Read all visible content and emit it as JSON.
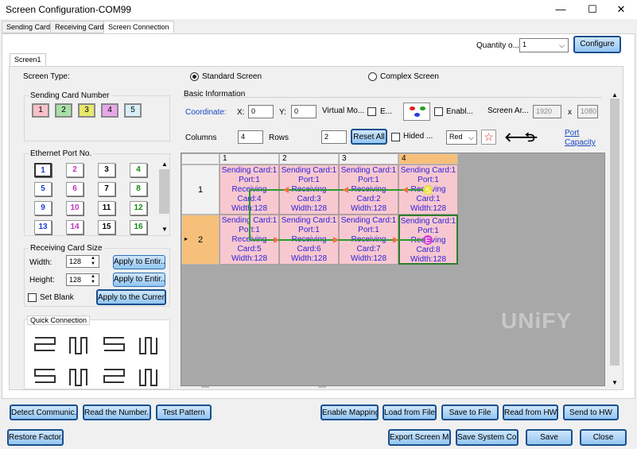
{
  "window": {
    "title": "Screen Configuration-COM99",
    "minimize": "—",
    "maximize": "☐",
    "close": "✕"
  },
  "tabs": [
    "Sending Card",
    "Receiving Card",
    "Screen Connection"
  ],
  "quantity": {
    "label": "Quantity o...",
    "value": "1",
    "configure": "Configure"
  },
  "screen_tab": "Screen1",
  "screen_type": {
    "label": "Screen Type:",
    "standard": "Standard Screen",
    "complex": "Complex Screen"
  },
  "sending_card": {
    "title": "Sending Card Number",
    "items": [
      {
        "label": "1",
        "color": "#f8c0c8"
      },
      {
        "label": "2",
        "color": "#a8e0a8"
      },
      {
        "label": "3",
        "color": "#e8e870"
      },
      {
        "label": "4",
        "color": "#e8a8e8"
      },
      {
        "label": "5",
        "color": "#d8eef8"
      }
    ]
  },
  "ethernet": {
    "title": "Ethernet Port No.",
    "ports": [
      {
        "label": "1",
        "color": "#1a3fd8"
      },
      {
        "label": "2",
        "color": "#c030c0"
      },
      {
        "label": "3",
        "color": "#000000"
      },
      {
        "label": "4",
        "color": "#128a12"
      },
      {
        "label": "5",
        "color": "#1a3fd8"
      },
      {
        "label": "6",
        "color": "#c030c0"
      },
      {
        "label": "7",
        "color": "#000000"
      },
      {
        "label": "8",
        "color": "#128a12"
      },
      {
        "label": "9",
        "color": "#1a3fd8"
      },
      {
        "label": "10",
        "color": "#c030c0"
      },
      {
        "label": "11",
        "color": "#000000"
      },
      {
        "label": "12",
        "color": "#128a12"
      },
      {
        "label": "13",
        "color": "#1a3fd8"
      },
      {
        "label": "14",
        "color": "#c030c0"
      },
      {
        "label": "15",
        "color": "#000000"
      },
      {
        "label": "16",
        "color": "#128a12"
      }
    ]
  },
  "recv_size": {
    "title": "Receiving Card Size",
    "width_label": "Width:",
    "width": "128",
    "height_label": "Height:",
    "height": "128",
    "apply_width": "Apply to Entir...",
    "apply_height": "Apply to Entir...",
    "set_blank": "Set Blank",
    "apply_current": "Apply to the Curren..."
  },
  "quick": {
    "title": "Quick Connection"
  },
  "basic": {
    "title": "Basic Information",
    "coordinate": "Coordinate:",
    "x_label": "X:",
    "x": "0",
    "y_label": "Y:",
    "y": "0",
    "virtual": "Virtual Mo...",
    "e": "E...",
    "enable": "Enabl...",
    "screen_ar": "Screen Ar...",
    "sw": "1920",
    "x_sep": "x",
    "sh": "1080",
    "columns_label": "Columns",
    "columns": "4",
    "rows_label": "Rows",
    "rows": "2",
    "reset": "Reset All",
    "hided": "Hided ...",
    "color": "Red",
    "port_capacity": "Port Capacity"
  },
  "grid": {
    "col_headers": [
      "1",
      "2",
      "3",
      "4"
    ],
    "row_headers": [
      "1",
      "2"
    ],
    "cells": [
      [
        "Sending Card:1\nPort:1\nReceiving\nCard:4\nWidth:128",
        "Sending Card:1\nPort:1\nReceiving\nCard:3\nWidth:128",
        "Sending Card:1\nPort:1\nReceiving\nCard:2\nWidth:128",
        "Sending Card:1\nPort:1\nReceiving\nCard:1\nWidth:128"
      ],
      [
        "Sending Card:1\nPort:1\nReceiving\nCard:5\nWidth:128",
        "Sending Card:1\nPort:1\nReceiving\nCard:6\nWidth:128",
        "Sending Card:1\nPort:1\nReceiving\nCard:7\nWidth:128",
        "Sending Card:1\nPort:1\nReceiving\nCard:8\nWidth:128"
      ]
    ],
    "start_marker": "S",
    "end_marker": "E",
    "watermark": "UNiFY"
  },
  "bottom": {
    "detect": "Detect Communic...",
    "read": "Read the Number...",
    "test": "Test Pattern",
    "enable_mapping": "Enable Mapping",
    "load": "Load from File",
    "save_file": "Save to File",
    "read_hw": "Read from HW",
    "send_hw": "Send to HW",
    "restore": "Restore Factor...",
    "export": "Export Screen M...",
    "save_sys": "Save System Co...",
    "save": "Save",
    "close": "Close"
  }
}
